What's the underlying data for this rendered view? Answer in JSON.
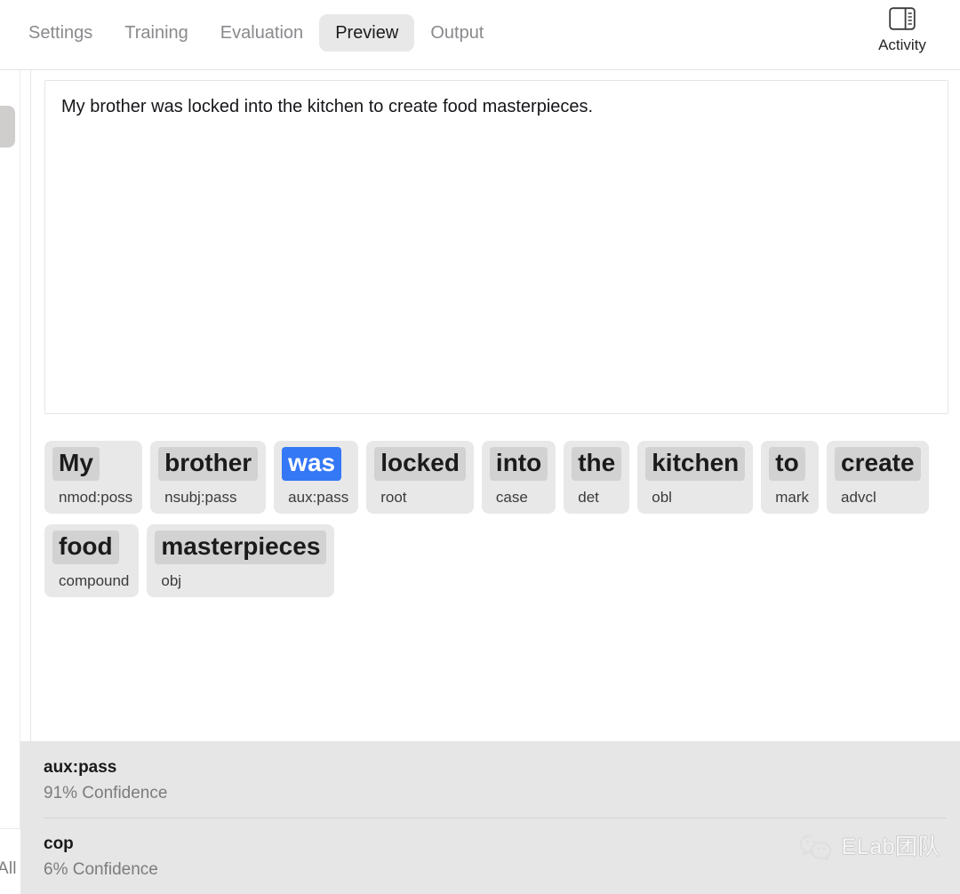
{
  "header": {
    "tabs": [
      {
        "label": "Settings",
        "active": false
      },
      {
        "label": "Training",
        "active": false
      },
      {
        "label": "Evaluation",
        "active": false
      },
      {
        "label": "Preview",
        "active": true
      },
      {
        "label": "Output",
        "active": false
      }
    ],
    "activity": {
      "label": "Activity",
      "icon": "panel-layout-icon"
    }
  },
  "editor": {
    "text": "My brother was locked into the kitchen to create food masterpieces."
  },
  "tokens": [
    {
      "word": "My",
      "dep": "nmod:poss",
      "selected": false
    },
    {
      "word": "brother",
      "dep": "nsubj:pass",
      "selected": false
    },
    {
      "word": "was",
      "dep": "aux:pass",
      "selected": true
    },
    {
      "word": "locked",
      "dep": "root",
      "selected": false
    },
    {
      "word": "into",
      "dep": "case",
      "selected": false
    },
    {
      "word": "the",
      "dep": "det",
      "selected": false
    },
    {
      "word": "kitchen",
      "dep": "obl",
      "selected": false
    },
    {
      "word": "to",
      "dep": "mark",
      "selected": false
    },
    {
      "word": "create",
      "dep": "advcl",
      "selected": false
    },
    {
      "word": "food",
      "dep": "compound",
      "selected": false
    },
    {
      "word": "masterpieces",
      "dep": "obj",
      "selected": false
    }
  ],
  "suggestions": [
    {
      "label": "aux:pass",
      "confidence": "91% Confidence"
    },
    {
      "label": "cop",
      "confidence": "6% Confidence"
    }
  ],
  "left_rail": {
    "all_label": "All",
    "handle": "drag-handle"
  },
  "watermark": {
    "text": "ELab团队",
    "icon": "wechat-icon"
  },
  "colors": {
    "accent_blue": "#3478f6",
    "chip_bg": "#e8e8e8",
    "chip_word_bg": "#d2d2d2",
    "panel_bg": "#e6e6e6",
    "muted_text": "#8a8a8e"
  }
}
